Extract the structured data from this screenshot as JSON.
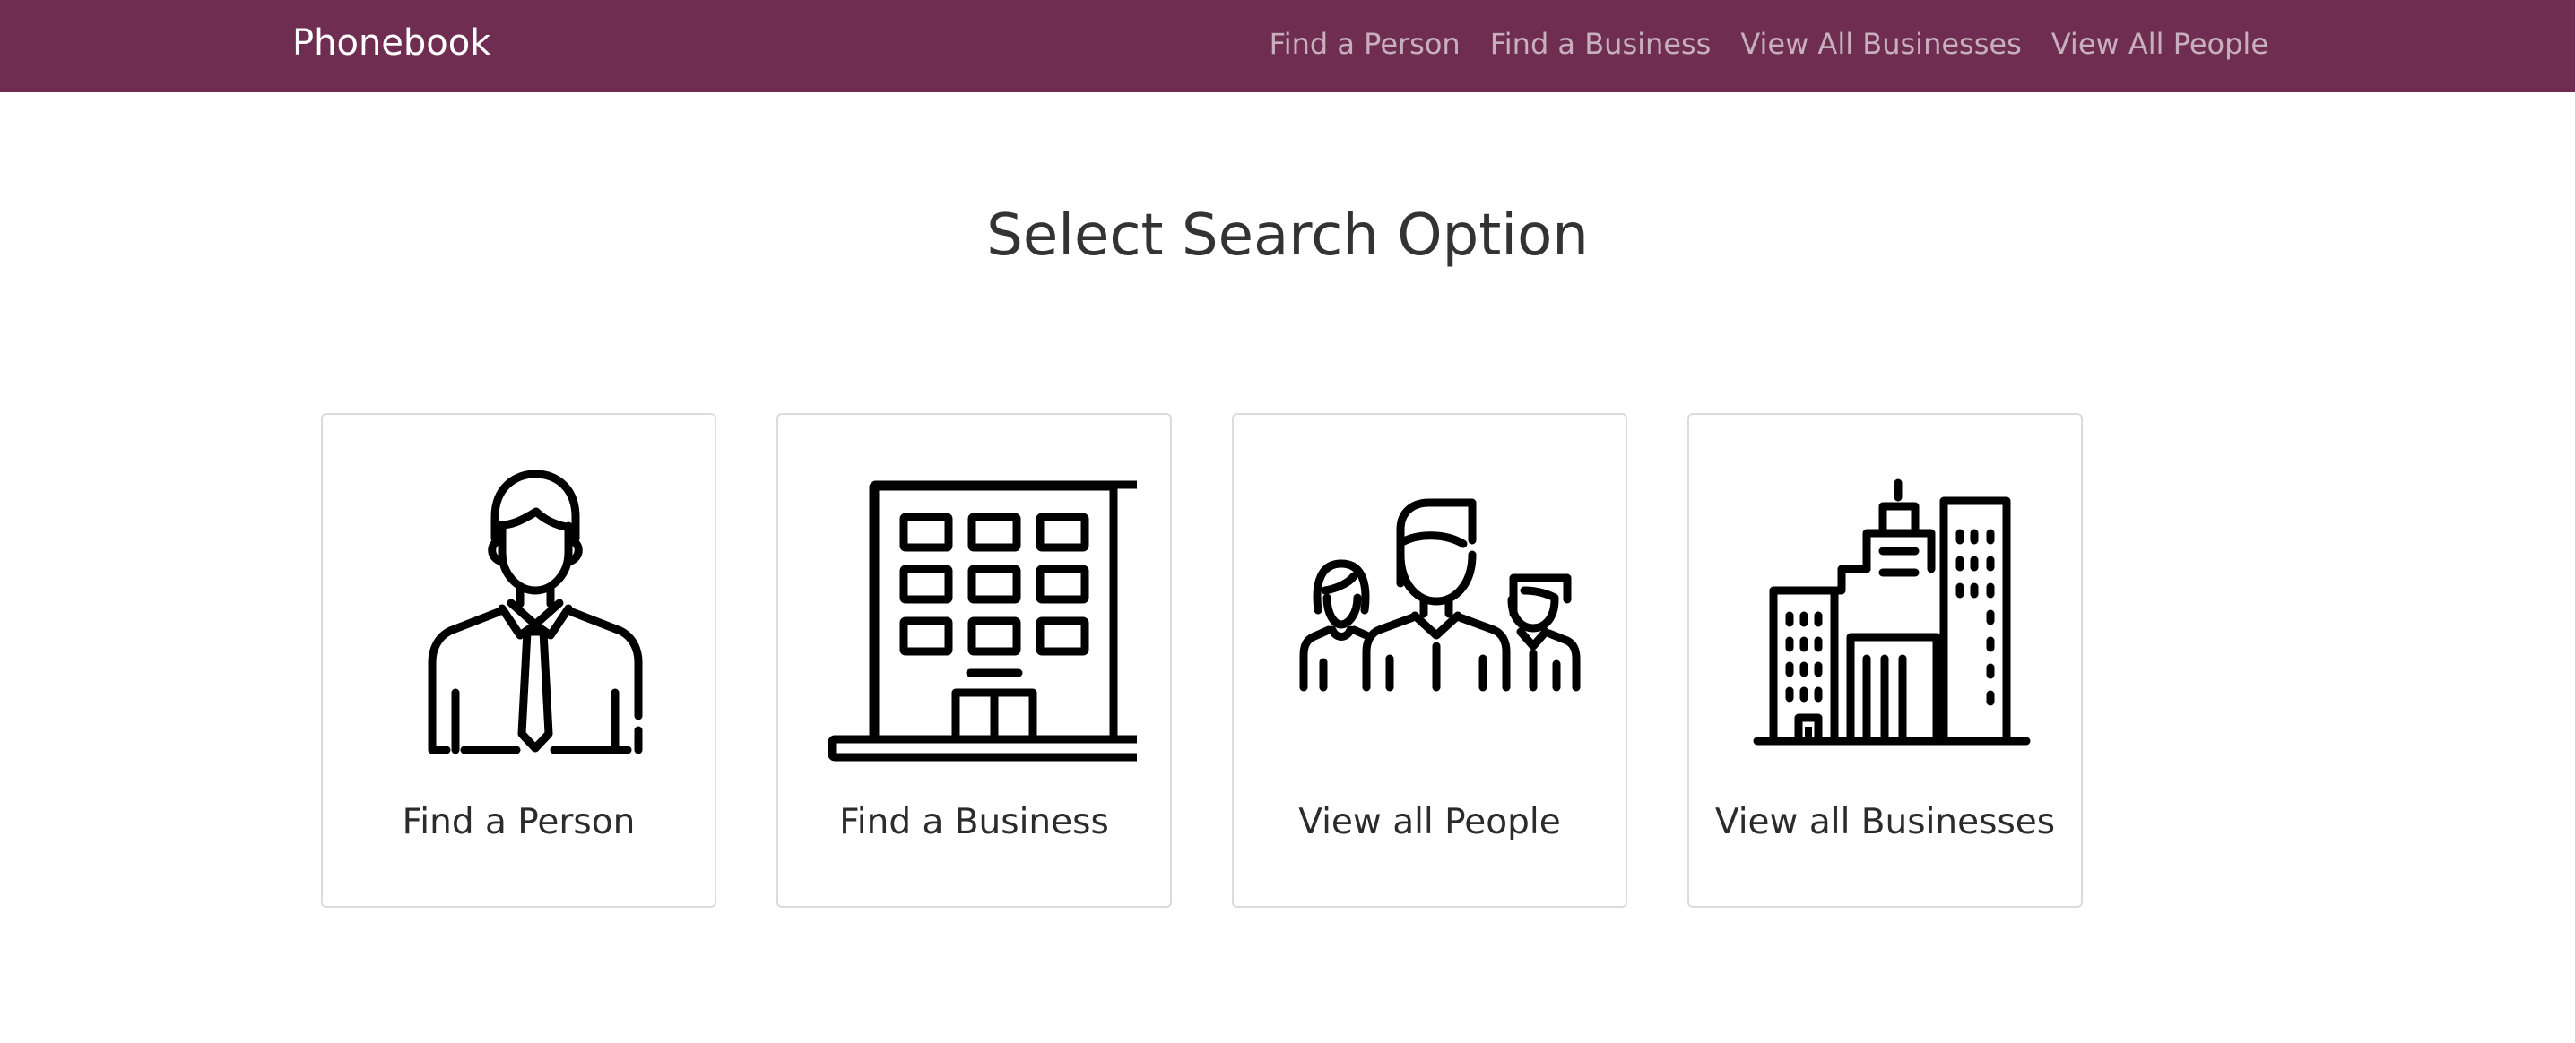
{
  "navbar": {
    "brand": "Phonebook",
    "links": [
      {
        "label": "Find a Person"
      },
      {
        "label": "Find a Business"
      },
      {
        "label": "View All Businesses"
      },
      {
        "label": "View All People"
      }
    ]
  },
  "main": {
    "heading": "Select Search Option",
    "cards": [
      {
        "label": "Find a Person",
        "icon": "businessman-icon"
      },
      {
        "label": "Find a Business",
        "icon": "office-building-icon"
      },
      {
        "label": "View all People",
        "icon": "people-group-icon"
      },
      {
        "label": "View all Businesses",
        "icon": "city-buildings-icon"
      }
    ]
  },
  "colors": {
    "navbar_bg": "#6e2d51",
    "brand_text": "#ffffff",
    "nav_link_text": "#c9aab9",
    "card_border": "#dcdcdc",
    "icon_stroke": "#000000"
  }
}
